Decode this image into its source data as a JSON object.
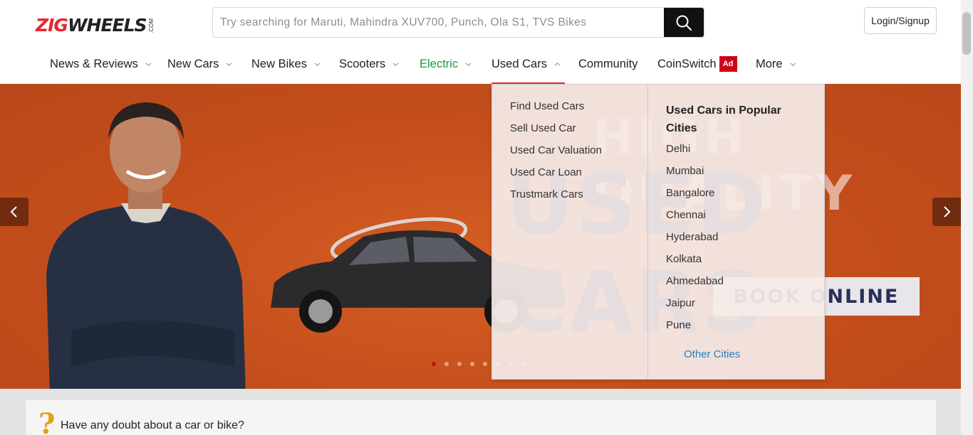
{
  "logo": {
    "part1": "ZIG",
    "part2": "WHEELS",
    "suffix": ".COM"
  },
  "search": {
    "placeholder": "Try searching for Maruti, Mahindra XUV700, Punch, Ola S1, TVS Bikes"
  },
  "login_label": "Login/Signup",
  "nav": [
    {
      "label": "News & Reviews"
    },
    {
      "label": "New Cars"
    },
    {
      "label": "New Bikes"
    },
    {
      "label": "Scooters"
    },
    {
      "label": "Electric"
    },
    {
      "label": "Used Cars"
    },
    {
      "label": "Community"
    },
    {
      "label": "CoinSwitch",
      "badge": "Ad"
    },
    {
      "label": "More"
    }
  ],
  "hero": {
    "headline1": "HIGH QUALITY",
    "headline2": "USED CARS",
    "cta": "BOOK ONLINE",
    "slides_total": 8,
    "active_slide": 1
  },
  "dropdown": {
    "links": [
      "Find Used Cars",
      "Sell Used Car",
      "Used Car Valuation",
      "Used Car Loan",
      "Trustmark Cars"
    ],
    "cities_title": "Used Cars in Popular Cities",
    "cities": [
      "Delhi",
      "Mumbai",
      "Bangalore",
      "Chennai",
      "Hyderabad",
      "Kolkata",
      "Ahmedabad",
      "Jaipur",
      "Pune"
    ],
    "other": "Other Cities"
  },
  "faq": {
    "icon": "?",
    "text": "Have any doubt about a car or bike?"
  },
  "colors": {
    "brand_red": "#e8262e",
    "electric_green": "#1a9a3c",
    "hero_orange": "#c9521e",
    "link_blue": "#2b7bb9"
  }
}
